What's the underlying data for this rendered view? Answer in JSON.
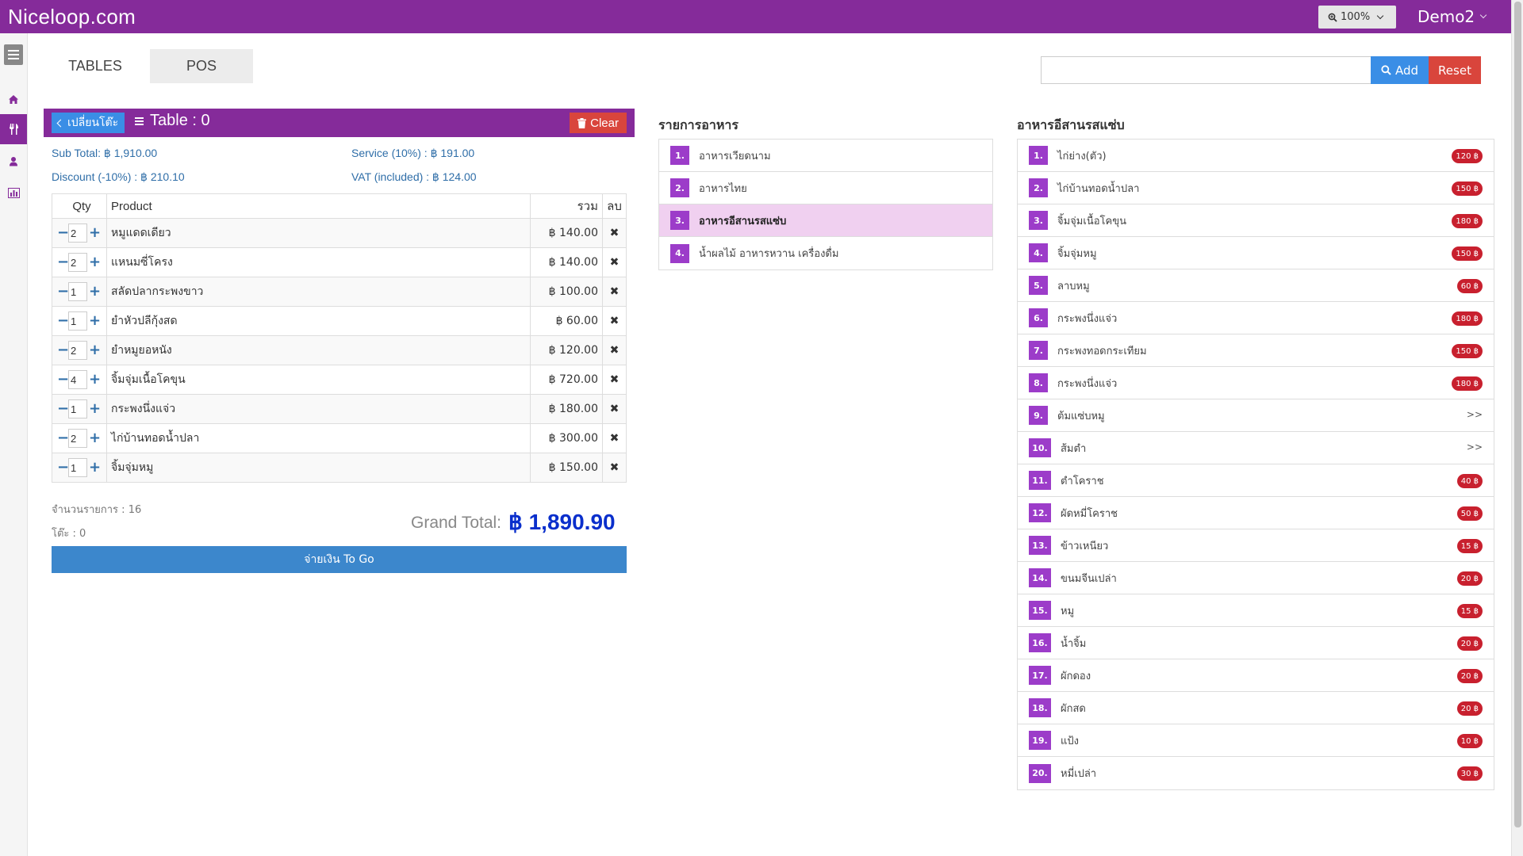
{
  "app": {
    "brand": "Niceloop.com",
    "zoom": "100%",
    "user": "Demo2"
  },
  "tabs": [
    {
      "label": "TABLES"
    },
    {
      "label": "POS"
    }
  ],
  "search": {
    "value": "",
    "add_label": "Add",
    "reset_label": "Reset"
  },
  "order": {
    "back_label": "เปลี่ยนโต๊ะ",
    "table_title": "Table : 0",
    "clear_label": "Clear",
    "subtotal": "Sub Total: ฿ 1,910.00",
    "service": "Service (10%) : ฿ 191.00",
    "discount": "Discount (-10%) : ฿ 210.10",
    "vat": "VAT (included) : ฿ 124.00",
    "columns": {
      "qty": "Qty",
      "product": "Product",
      "total": "รวม",
      "delete": "ลบ"
    },
    "items": [
      {
        "qty": "2",
        "product": "หมูแดดเดียว",
        "total": "฿ 140.00"
      },
      {
        "qty": "2",
        "product": "แหนมซี่โครง",
        "total": "฿ 140.00"
      },
      {
        "qty": "1",
        "product": "สลัดปลากระพงขาว",
        "total": "฿ 100.00"
      },
      {
        "qty": "1",
        "product": "ยำหัวปลีกุ้งสด",
        "total": "฿ 60.00"
      },
      {
        "qty": "2",
        "product": "ยำหมูยอหนัง",
        "total": "฿ 120.00"
      },
      {
        "qty": "4",
        "product": "จิ้มจุ่มเนื้อโคขุน",
        "total": "฿ 720.00"
      },
      {
        "qty": "1",
        "product": "กระพงนึ่งแจ่ว",
        "total": "฿ 180.00"
      },
      {
        "qty": "2",
        "product": "ไก่บ้านทอดน้ำปลา",
        "total": "฿ 300.00"
      },
      {
        "qty": "1",
        "product": "จิ้มจุ่มหมู",
        "total": "฿ 150.00"
      }
    ],
    "item_count": "จำนวนรายการ : 16",
    "table_no": "โต๊ะ : 0",
    "grand_total_label": "Grand Total:",
    "grand_total_value": "฿ 1,890.90",
    "pay_label": "จ่ายเงิน To Go"
  },
  "categories": {
    "title": "รายการอาหาร",
    "items": [
      {
        "num": "1.",
        "name": "อาหารเวียดนาม"
      },
      {
        "num": "2.",
        "name": "อาหารไทย"
      },
      {
        "num": "3.",
        "name": "อาหารอีสานรสแซ่บ"
      },
      {
        "num": "4.",
        "name": "น้ำผลไม้ อาหารหวาน เครื่องดื่ม"
      }
    ]
  },
  "menu": {
    "title": "อาหารอีสานรสแซ่บ",
    "items": [
      {
        "num": "1.",
        "name": "ไก่ย่าง(ตัว)",
        "price": "120 ฿"
      },
      {
        "num": "2.",
        "name": "ไก่บ้านทอดน้ำปลา",
        "price": "150 ฿"
      },
      {
        "num": "3.",
        "name": "จิ้มจุ่มเนื้อโคขุน",
        "price": "180 ฿"
      },
      {
        "num": "4.",
        "name": "จิ้มจุ่มหมู",
        "price": "150 ฿"
      },
      {
        "num": "5.",
        "name": "ลาบหมู",
        "price": "60 ฿"
      },
      {
        "num": "6.",
        "name": "กระพงนึ่งแจ่ว",
        "price": "180 ฿"
      },
      {
        "num": "7.",
        "name": "กระพงทอดกระเทียม",
        "price": "150 ฿"
      },
      {
        "num": "8.",
        "name": "กระพงนึ่งแจ่ว",
        "price": "180 ฿"
      },
      {
        "num": "9.",
        "name": "ต้มแซ่บหมู",
        "more": ">>"
      },
      {
        "num": "10.",
        "name": "ส้มตำ",
        "more": ">>"
      },
      {
        "num": "11.",
        "name": "ตำโคราช",
        "price": "40 ฿"
      },
      {
        "num": "12.",
        "name": "ผัดหมี่โคราช",
        "price": "50 ฿"
      },
      {
        "num": "13.",
        "name": "ข้าวเหนียว",
        "price": "15 ฿"
      },
      {
        "num": "14.",
        "name": "ขนมจีนเปล่า",
        "price": "20 ฿"
      },
      {
        "num": "15.",
        "name": "หมู",
        "price": "15 ฿"
      },
      {
        "num": "16.",
        "name": "น้ำจิ้ม",
        "price": "20 ฿"
      },
      {
        "num": "17.",
        "name": "ผักดอง",
        "price": "20 ฿"
      },
      {
        "num": "18.",
        "name": "ผักสด",
        "price": "20 ฿"
      },
      {
        "num": "19.",
        "name": "แป้ง",
        "price": "10 ฿"
      },
      {
        "num": "20.",
        "name": "หมี่เปล่า",
        "price": "30 ฿"
      }
    ]
  },
  "colors": {
    "brand": "#852b9a",
    "primary": "#3a8ee6",
    "danger": "#d9453c",
    "badge": "#9c3cc9",
    "grand_total": "#0a2fcc"
  }
}
